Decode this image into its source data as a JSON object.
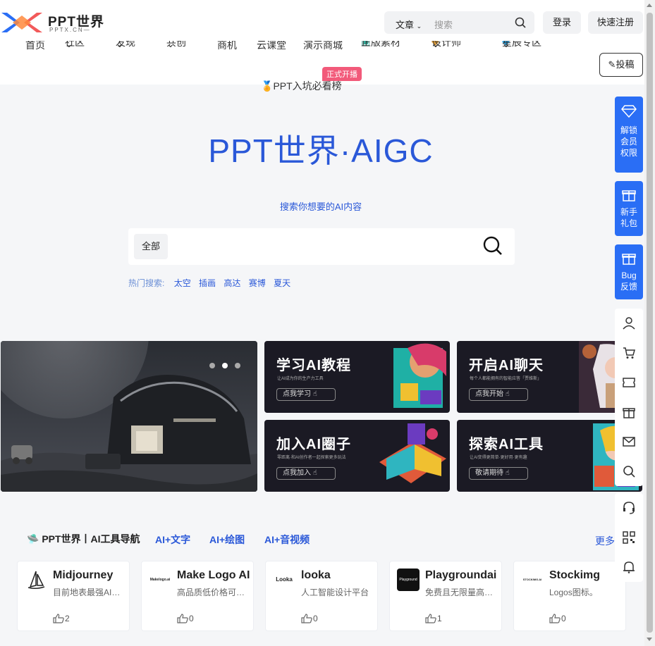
{
  "header": {
    "logo_text": "PPT世界",
    "logo_sub": "PPTX.CN—",
    "search_category": "文章",
    "search_placeholder": "搜索",
    "login": "登录",
    "register": "快速注册",
    "post": "投稿"
  },
  "nav": {
    "items": [
      "首页",
      "社区",
      "发现",
      "共创",
      "商机",
      "云课堂",
      "演示商城",
      "正版素材",
      "设计师",
      "星辰专区"
    ]
  },
  "hot_link": {
    "label": "PPT入坑必看榜",
    "badge": "正式开播"
  },
  "hero": {
    "title": "PPT世界·AIGC",
    "subtitle": "搜索你想要的AI内容",
    "scope": "全部",
    "hot_label": "热门搜索:",
    "hot_keywords": [
      "太空",
      "插画",
      "高达",
      "赛博",
      "夏天"
    ]
  },
  "promos": [
    {
      "title": "学习AI教程",
      "desc": "让AI成为你的生产力工具",
      "button": "点我学习"
    },
    {
      "title": "开启AI聊天",
      "desc": "每个人都能拥有的智能应答「贾维斯」",
      "button": "点我开始"
    },
    {
      "title": "加入AI圈子",
      "desc": "零距离·和AI创作者一起探索更多玩法",
      "button": "点我加入"
    },
    {
      "title": "探索AI工具",
      "desc": "让AI变得更简单·更好用·更有趣",
      "button": "敬请期待"
    }
  ],
  "section": {
    "main": "PPT世界丨AI工具导航",
    "tabs": [
      "AI+文字",
      "AI+绘图",
      "AI+音视频"
    ],
    "more": "更多"
  },
  "cards": [
    {
      "name": "Midjourney",
      "desc": "目前地表最强AI绘图工具",
      "likes": "2",
      "logo_text": ""
    },
    {
      "name": "Make Logo AI",
      "desc": "高品质低价格可商用",
      "likes": "0",
      "logo_text": "Makelogo.ai"
    },
    {
      "name": "looka",
      "desc": "人工智能设计平台",
      "likes": "0",
      "logo_text": "Looka"
    },
    {
      "name": "Playgroundai",
      "desc": "免费且无限量高质量图片",
      "likes": "1",
      "logo_text": "Playground"
    },
    {
      "name": "Stockimg",
      "desc": "Logos图标。",
      "likes": "0",
      "logo_text": "STOCKIMG.AI"
    }
  ],
  "sidebar": {
    "vip": "解锁会员权限",
    "gift": "新手礼包",
    "bug": "Bug反馈"
  },
  "colors": {
    "accent": "#2a58d8",
    "sidebar_blue": "#2a6ef5",
    "badge": "#f25a7a"
  }
}
